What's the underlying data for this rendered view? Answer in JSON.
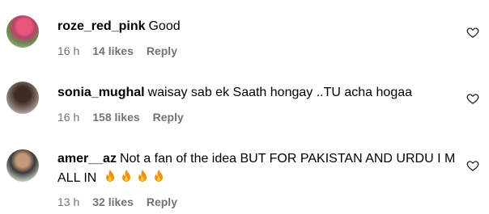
{
  "comments": [
    {
      "username": "roze_red_pink",
      "text": "Good",
      "time": "16 h",
      "likes": "14 likes",
      "reply": "Reply"
    },
    {
      "username": "sonia_mughal",
      "text": "waisay sab ek Saath hongay ..TU acha hogaa",
      "time": "16 h",
      "likes": "158 likes",
      "reply": "Reply"
    },
    {
      "username": "amer__az",
      "text": "Not a fan of the idea BUT FOR PAKISTAN AND URDU I M ALL IN",
      "emoji": "🔥",
      "time": "13 h",
      "likes": "32 likes",
      "reply": "Reply"
    }
  ],
  "icons": {
    "like": "heart-outline-icon",
    "fire": "fire-emoji-icon"
  },
  "colors": {
    "meta_text": "#737373",
    "fire": "#f4900c"
  }
}
